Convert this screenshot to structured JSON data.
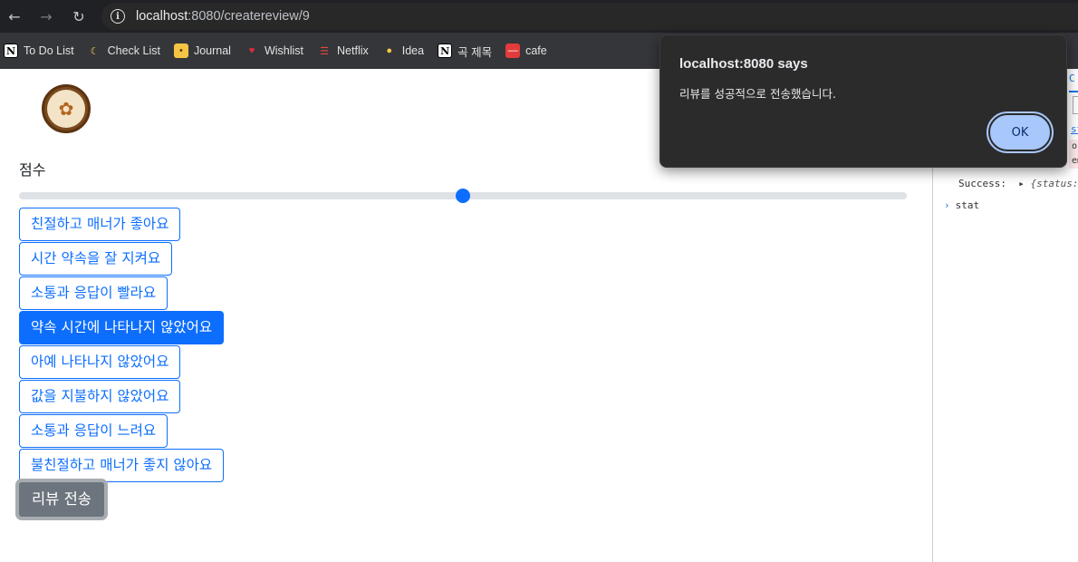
{
  "browser": {
    "url_host": "localhost",
    "url_path": ":8080/createreview/9",
    "bookmarks": [
      {
        "label": "To Do List",
        "icon": "notion-icon"
      },
      {
        "label": "Check List",
        "icon": "banana-icon"
      },
      {
        "label": "Journal",
        "icon": "journal-icon"
      },
      {
        "label": "Wishlist",
        "icon": "heart-icon"
      },
      {
        "label": "Netflix",
        "icon": "popcorn-icon"
      },
      {
        "label": "Idea",
        "icon": "bulb-icon"
      },
      {
        "label": "곡 제목",
        "icon": "notion-icon"
      },
      {
        "label": "cafe",
        "icon": "cafe-icon"
      }
    ]
  },
  "page": {
    "score_label": "점수",
    "score_fraction": 0.5,
    "tags": [
      {
        "label": "친절하고 매너가 좋아요",
        "active": false
      },
      {
        "label": "시간 약속을 잘 지켜요",
        "active": false
      },
      {
        "label": "소통과 응답이 빨라요",
        "active": false
      },
      {
        "label": "약속 시간에 나타나지 않았어요",
        "active": true
      },
      {
        "label": "아예 나타나지 않았어요",
        "active": false
      },
      {
        "label": "값을 지불하지 않았어요",
        "active": false
      },
      {
        "label": "소통과 응답이 느려요",
        "active": false
      },
      {
        "label": "불친절하고 매너가 좋지 않아요",
        "active": false
      }
    ],
    "submit_label": "리뷰 전송"
  },
  "devtools": {
    "tab_fragment": "C",
    "link_fragment": "st",
    "hl_line1": "or",
    "hl_line2": "em",
    "row1_label": "Success:",
    "row1_value": "{status:",
    "row2_value": "stat"
  },
  "dialog": {
    "title": "localhost:8080 says",
    "message": "리뷰를 성공적으로 전송했습니다.",
    "ok_label": "OK"
  },
  "colors": {
    "primary": "#0d6efd",
    "secondary": "#6c757d",
    "dialog_bg": "#2b2b2b",
    "ok_bg": "#a8c7fa"
  }
}
